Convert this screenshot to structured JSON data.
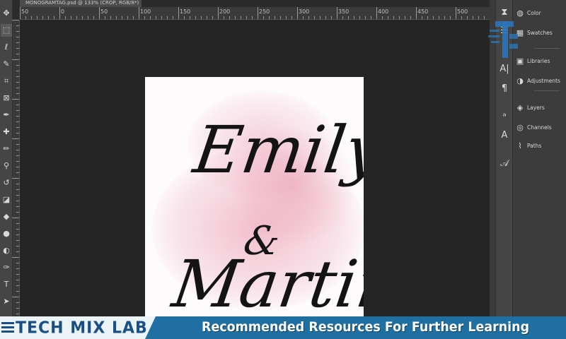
{
  "document": {
    "tab_title": "MONOGRAMTAG.psd @ 133% (CROP, RGB/8*)"
  },
  "ruler": {
    "labels": [
      "50",
      "0",
      "50",
      "100",
      "150",
      "200",
      "250",
      "300",
      "350",
      "400",
      "450",
      "500"
    ]
  },
  "toolbar": {
    "tools": [
      {
        "name": "move-tool",
        "glyph": "✥"
      },
      {
        "name": "marquee-tool",
        "glyph": "⬚"
      },
      {
        "name": "lasso-tool",
        "glyph": "ℓ"
      },
      {
        "name": "quick-select-tool",
        "glyph": "✎"
      },
      {
        "name": "crop-tool",
        "glyph": "⌗"
      },
      {
        "name": "frame-tool",
        "glyph": "⊠"
      },
      {
        "name": "eyedropper-tool",
        "glyph": "✒"
      },
      {
        "name": "healing-brush-tool",
        "glyph": "✚"
      },
      {
        "name": "brush-tool",
        "glyph": "✏"
      },
      {
        "name": "clone-stamp-tool",
        "glyph": "⚲"
      },
      {
        "name": "history-brush-tool",
        "glyph": "↺"
      },
      {
        "name": "eraser-tool",
        "glyph": "◪"
      },
      {
        "name": "gradient-tool",
        "glyph": "◆"
      },
      {
        "name": "blur-tool",
        "glyph": "●"
      },
      {
        "name": "dodge-tool",
        "glyph": "◐"
      },
      {
        "name": "pen-tool",
        "glyph": "✑"
      },
      {
        "name": "type-tool",
        "glyph": "T"
      },
      {
        "name": "path-select-tool",
        "glyph": "➤"
      }
    ]
  },
  "iconbar": {
    "icons": [
      {
        "name": "history-icon",
        "glyph": "⧗"
      },
      {
        "name": "properties-icon",
        "glyph": "☰"
      },
      {
        "name": "character-icon",
        "glyph": "A|"
      },
      {
        "name": "paragraph-icon",
        "glyph": "¶"
      },
      {
        "name": "glyphs-icon",
        "glyph": "ᵃ"
      },
      {
        "name": "character-styles-icon",
        "glyph": "A"
      },
      {
        "name": "paragraph-styles-icon",
        "glyph": "𝒜"
      }
    ]
  },
  "panels": {
    "items": [
      {
        "name": "color",
        "label": "Color",
        "glyph": "◍"
      },
      {
        "name": "swatches",
        "label": "Swatches",
        "glyph": "▦"
      },
      {
        "name": "libraries",
        "label": "Libraries",
        "glyph": "▣"
      },
      {
        "name": "adjustments",
        "label": "Adjustments",
        "glyph": "◑"
      },
      {
        "name": "layers",
        "label": "Layers",
        "glyph": "◈"
      },
      {
        "name": "channels",
        "label": "Channels",
        "glyph": "◎"
      },
      {
        "name": "paths",
        "label": "Paths",
        "glyph": "⌇"
      }
    ]
  },
  "artwork": {
    "line1": "Emily",
    "ampersand": "&",
    "line2": "Martin"
  },
  "banner": {
    "brand": "TECH MIX LAB",
    "headline": "Recommended Resources For Further Learning",
    "colors": {
      "bar": "#1f6fa3",
      "brand": "#1a4f86",
      "panel": "#ecf3f7"
    }
  }
}
